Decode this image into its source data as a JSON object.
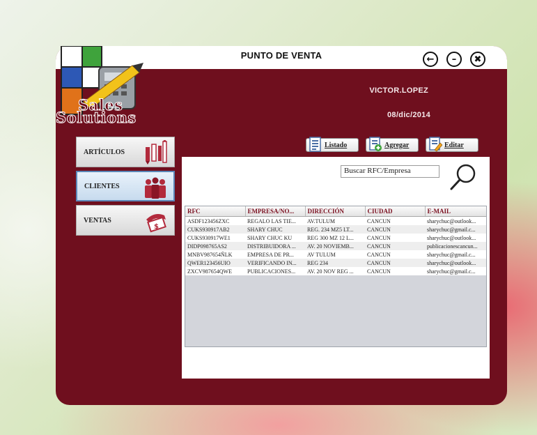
{
  "window": {
    "title": "PUNTO DE VENTA",
    "controls": [
      "back-icon",
      "minimize-icon",
      "close-icon"
    ]
  },
  "logo": {
    "line1": "Sales",
    "line2": "Solutions"
  },
  "user": {
    "name": "VICTOR.LOPEZ",
    "date": "08/dic/2014"
  },
  "sidebar": {
    "items": [
      {
        "label": "ARTÍCULOS",
        "icon": "pencils-icon"
      },
      {
        "label": "CLIENTES",
        "icon": "people-icon",
        "active": true
      },
      {
        "label": "VENTAS",
        "icon": "money-hand-icon"
      }
    ]
  },
  "toolbar": {
    "list_label": "Listado",
    "add_label": "Agregar",
    "edit_label": "Editar"
  },
  "search": {
    "value": "Buscar RFC/Empresa"
  },
  "table": {
    "columns": [
      "RFC",
      "EMPRESA/NO...",
      "DIRECCIÓN",
      "CIUDAD",
      "E-MAIL"
    ],
    "rows": [
      [
        "ASDF123456ZXC",
        "REGALO LAS TIE...",
        "AV.TULUM",
        "CANCUN",
        "sharychuc@outlook..."
      ],
      [
        "CUKS930917AB2",
        "SHARY CHUC",
        "REG. 234 MZ5 LT...",
        "CANCUN",
        "sharychuc@gmail.c..."
      ],
      [
        "CUKS930917WE1",
        "SHARY CHUC KU",
        "REG 300 MZ 12 L...",
        "CANCUN",
        "sharychuc@outlook..."
      ],
      [
        "DIDP098765AS2",
        "DISTRIBUIDORA ...",
        "AV. 20 NOVIEMB...",
        "CANCUN",
        "publicacionescancun..."
      ],
      [
        "MNBV987654ÑLK",
        "EMPRESA DE PR...",
        "AV TULUM",
        "CANCUN",
        "sharychuc@gmail.c..."
      ],
      [
        "QWER123456UIO",
        "VERIFICANDO IN...",
        "REG 234",
        "CANCUN",
        "sharychuc@outlook..."
      ],
      [
        "ZXCV987654QWE",
        "PUBLICACIONES...",
        "AV. 20 NOV REG ...",
        "CANCUN",
        "sharychuc@gmail.c..."
      ]
    ]
  },
  "colors": {
    "maroon": "#6f0f1e",
    "header_text": "#7a1020"
  }
}
